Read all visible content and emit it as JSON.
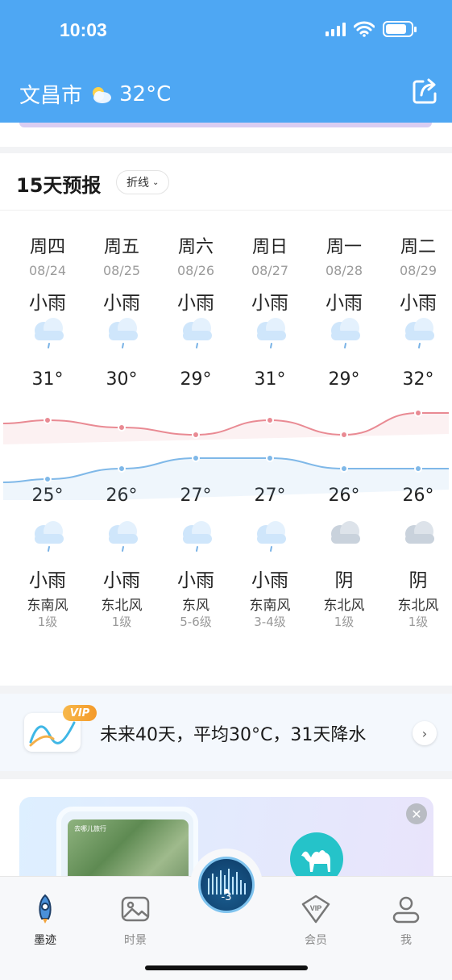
{
  "status_bar": {
    "time": "10:03"
  },
  "header": {
    "city": "文昌市",
    "current_temp": "32°C",
    "weather_icon": "partly-cloudy-icon",
    "share_icon": "share-icon"
  },
  "forecast": {
    "title": "15天预报",
    "mode_label": "折线",
    "days": [
      {
        "weekday": "周四",
        "date": "08/24",
        "day_cond": "小雨",
        "day_icon": "light-rain-icon",
        "high": "31°",
        "low": "25°",
        "night_icon": "light-rain-icon",
        "night_cond": "小雨",
        "wind": "东南风",
        "level": "1级"
      },
      {
        "weekday": "周五",
        "date": "08/25",
        "day_cond": "小雨",
        "day_icon": "light-rain-icon",
        "high": "30°",
        "low": "26°",
        "night_icon": "light-rain-icon",
        "night_cond": "小雨",
        "wind": "东北风",
        "level": "1级"
      },
      {
        "weekday": "周六",
        "date": "08/26",
        "day_cond": "小雨",
        "day_icon": "light-rain-icon",
        "high": "29°",
        "low": "27°",
        "night_icon": "light-rain-icon",
        "night_cond": "小雨",
        "wind": "东风",
        "level": "5-6级"
      },
      {
        "weekday": "周日",
        "date": "08/27",
        "day_cond": "小雨",
        "day_icon": "light-rain-icon",
        "high": "31°",
        "low": "27°",
        "night_icon": "light-rain-icon",
        "night_cond": "小雨",
        "wind": "东南风",
        "level": "3-4级"
      },
      {
        "weekday": "周一",
        "date": "08/28",
        "day_cond": "小雨",
        "day_icon": "light-rain-icon",
        "high": "29°",
        "low": "26°",
        "night_icon": "overcast-icon",
        "night_cond": "阴",
        "wind": "东北风",
        "level": "1级"
      },
      {
        "weekday": "周二",
        "date": "08/29",
        "day_cond": "小雨",
        "day_icon": "light-rain-icon",
        "high": "32°",
        "low": "26°",
        "night_icon": "overcast-icon",
        "night_cond": "阴",
        "wind": "东北风",
        "level": "1级"
      }
    ],
    "colors": {
      "high_line": "#e98a93",
      "low_line": "#7fb8e8"
    }
  },
  "chart_data": {
    "type": "line",
    "categories": [
      "周四",
      "周五",
      "周六",
      "周日",
      "周一",
      "周二"
    ],
    "series": [
      {
        "values": [
          31,
          30,
          29,
          31,
          29,
          32
        ]
      },
      {
        "values": [
          25,
          26,
          27,
          27,
          26,
          26
        ]
      }
    ]
  },
  "vip_banner": {
    "badge": "VIP",
    "text": "未来40天，平均30°C，31天降水",
    "arrow_icon": "chevron-right-icon"
  },
  "ad": {
    "photo_label": "去哪儿旅行",
    "close_icon": "close-icon",
    "camel_icon": "camel-icon"
  },
  "center_button": {
    "value": "-3"
  },
  "tabbar": {
    "tabs": [
      {
        "label": "墨迹",
        "icon": "rocket-icon",
        "active": true
      },
      {
        "label": "时景",
        "icon": "picture-icon",
        "active": false
      },
      {
        "label": "会员",
        "icon": "vip-icon",
        "active": false
      },
      {
        "label": "我",
        "icon": "user-icon",
        "active": false
      }
    ]
  }
}
